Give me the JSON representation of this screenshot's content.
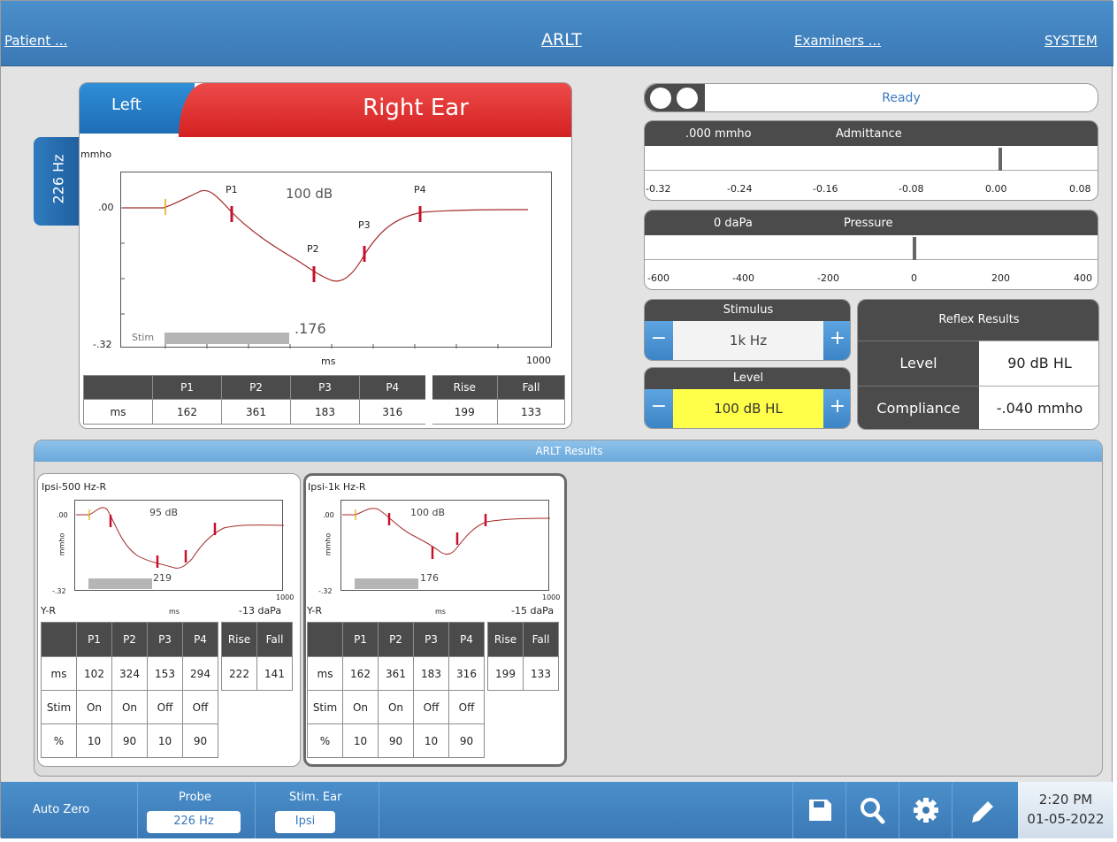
{
  "topbar": {
    "patient_link": "Patient ...",
    "title": "ARLT",
    "examiners_link": "Examiners ...",
    "system_link": "SYSTEM"
  },
  "main_graph": {
    "tab_left": "Left",
    "tab_right": "Right Ear",
    "probe_tab": "226 Hz",
    "y_unit": "mmho",
    "y_top": ".00",
    "y_bottom": "-.32",
    "x_unit": "ms",
    "x_max": "1000",
    "stim_label": "Stim",
    "stim_value": ".176",
    "db_label": "100 dB",
    "peaks": [
      "P1",
      "P2",
      "P3",
      "P4"
    ],
    "table": {
      "headers": [
        "",
        "P1",
        "P2",
        "P3",
        "P4",
        "Rise",
        "Fall"
      ],
      "row": [
        "ms",
        "162",
        "361",
        "183",
        "316",
        "199",
        "133"
      ]
    }
  },
  "status": {
    "text": "Ready"
  },
  "admittance": {
    "value": ".000 mmho",
    "label": "Admittance",
    "ticks": [
      "-0.32",
      "-0.24",
      "-0.16",
      "-0.08",
      "0.00",
      "0.08"
    ],
    "needle_value": 0.0
  },
  "pressure": {
    "value": "0 daPa",
    "label": "Pressure",
    "ticks": [
      "-600",
      "-400",
      "-200",
      "0",
      "200",
      "400"
    ],
    "needle_value": 0
  },
  "stimulus": {
    "label": "Stimulus",
    "value": "1k Hz",
    "minus": "−",
    "plus": "+"
  },
  "level": {
    "label": "Level",
    "value": "100 dB HL",
    "minus": "−",
    "plus": "+",
    "highlight": "#ffff4a"
  },
  "reflex": {
    "title": "Reflex Results",
    "level_label": "Level",
    "level_value": "90 dB HL",
    "compliance_label": "Compliance",
    "compliance_value": "-.040 mmho"
  },
  "results": {
    "title": "ARLT Results",
    "cards": [
      {
        "title": "Ipsi-500 Hz-R",
        "db": "95 dB",
        "stim_value": "219",
        "y_top": ".00",
        "y_bottom": "-.32",
        "y_unit": "mmho",
        "x_unit": "ms",
        "x_max": "1000",
        "ear": "Y-R",
        "pressure": "-13 daPa",
        "headers": [
          "",
          "P1",
          "P2",
          "P3",
          "P4"
        ],
        "rise_fall_headers": [
          "Rise",
          "Fall"
        ],
        "rows": [
          [
            "ms",
            "102",
            "324",
            "153",
            "294"
          ],
          [
            "Stim",
            "On",
            "On",
            "Off",
            "Off"
          ],
          [
            "%",
            "10",
            "90",
            "10",
            "90"
          ]
        ],
        "rise_fall": [
          "222",
          "141"
        ]
      },
      {
        "title": "Ipsi-1k Hz-R",
        "db": "100 dB",
        "stim_value": "176",
        "y_top": ".00",
        "y_bottom": "-.32",
        "y_unit": "mmho",
        "x_unit": "ms",
        "x_max": "1000",
        "ear": "Y-R",
        "pressure": "-15 daPa",
        "headers": [
          "",
          "P1",
          "P2",
          "P3",
          "P4"
        ],
        "rise_fall_headers": [
          "Rise",
          "Fall"
        ],
        "rows": [
          [
            "ms",
            "162",
            "361",
            "183",
            "316"
          ],
          [
            "Stim",
            "On",
            "On",
            "Off",
            "Off"
          ],
          [
            "%",
            "10",
            "90",
            "10",
            "90"
          ]
        ],
        "rise_fall": [
          "199",
          "133"
        ]
      }
    ]
  },
  "bottombar": {
    "auto_zero": "Auto Zero",
    "probe_label": "Probe",
    "probe_value": "226 Hz",
    "stim_ear_label": "Stim. Ear",
    "stim_ear_value": "Ipsi",
    "icons": [
      "save-icon",
      "search-icon",
      "gear-icon",
      "pencil-icon"
    ],
    "time": "2:20 PM",
    "date": "01-05-2022"
  },
  "colors": {
    "accent_blue": "#3b79b5",
    "right_ear_red": "#d42121",
    "left_ear_blue": "#1d6db6",
    "curve": "#a52a2a",
    "marker": "#c8102e"
  }
}
